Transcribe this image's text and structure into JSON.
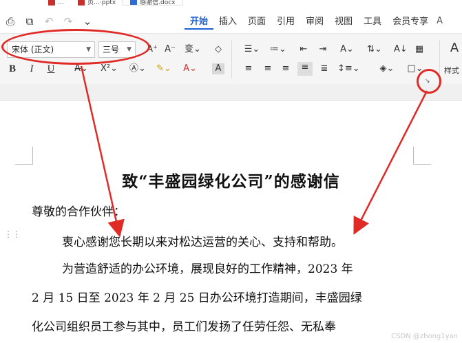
{
  "window": {
    "doc_tabs": [
      "…",
      "页…·pptx",
      "感谢信.docx"
    ]
  },
  "quick_access": {
    "icons": [
      "save-icon",
      "print-preview-icon",
      "undo-icon",
      "redo-icon",
      "more-icon"
    ]
  },
  "ribbon_tabs": [
    {
      "label": "开始",
      "active": true
    },
    {
      "label": "插入",
      "active": false
    },
    {
      "label": "页面",
      "active": false
    },
    {
      "label": "引用",
      "active": false
    },
    {
      "label": "审阅",
      "active": false
    },
    {
      "label": "视图",
      "active": false
    },
    {
      "label": "工具",
      "active": false
    },
    {
      "label": "会员专享",
      "active": false
    }
  ],
  "font": {
    "name": "宋体 (正文)",
    "size": "三号"
  },
  "toolbar": {
    "bold": "B",
    "italic": "I",
    "underline": "U",
    "styles_label": "样式"
  },
  "document": {
    "title": "致“丰盛园绿化公司”的感谢信",
    "paragraphs": [
      "尊敬的合作伙伴：",
      "衷心感谢您长期以来对松达运营的关心、支持和帮助。",
      "为营造舒适的办公环境，展现良好的工作精神，2023 年",
      "2 月 15 日至 2023 年 2 月 25 日办公环境打造期间，丰盛园绿",
      "化公司组织员工参与其中，员工们发扬了任劳任怨、无私奉"
    ]
  },
  "watermark": "CSDN @zhong1yan",
  "annotation_color": "#e02a26",
  "accent_color": "#1e5fd1"
}
